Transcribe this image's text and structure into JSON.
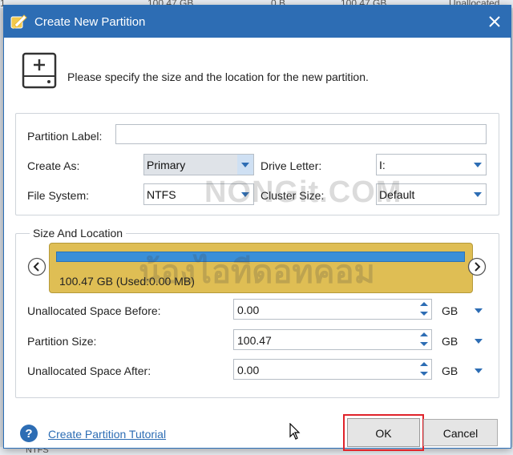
{
  "background": {
    "top_left_text": "1",
    "top_values": [
      "100.47 GB",
      "0 B",
      "100.47 GB",
      "Unallocated"
    ],
    "bottom_text": "NTFS"
  },
  "dialog": {
    "title": "Create New Partition",
    "app_icon": "partition-wizard-icon",
    "close_icon": "close-icon"
  },
  "header": {
    "icon": "add-drive-icon",
    "text": "Please specify the size and the location for the new partition."
  },
  "form": {
    "partition_label": {
      "label": "Partition Label:",
      "value": ""
    },
    "create_as": {
      "label": "Create As:",
      "value": "Primary"
    },
    "drive_letter": {
      "label": "Drive Letter:",
      "value": "I:"
    },
    "file_system": {
      "label": "File System:",
      "value": "NTFS"
    },
    "cluster_size": {
      "label": "Cluster Size:",
      "value": "Default"
    }
  },
  "size_location": {
    "title": "Size And Location",
    "partition_text": "100.47 GB (Used:0.00 MB)",
    "partition_fill": 1.0,
    "unallocated_before": {
      "label": "Unallocated Space Before:",
      "value": "0.00",
      "unit": "GB"
    },
    "partition_size": {
      "label": "Partition Size:",
      "value": "100.47",
      "unit": "GB"
    },
    "unallocated_after": {
      "label": "Unallocated Space After:",
      "value": "0.00",
      "unit": "GB"
    }
  },
  "watermark": {
    "line1": "NONGit.COM",
    "line2": "น้องไอทีดอทคอม"
  },
  "footer": {
    "tutorial_link": "Create Partition Tutorial",
    "ok_label": "OK",
    "cancel_label": "Cancel"
  },
  "colors": {
    "title_bar": "#2d6db4",
    "partition_box": "#dfbe54",
    "partition_bar": "#3a8fd8",
    "highlight": "#e0232a"
  }
}
